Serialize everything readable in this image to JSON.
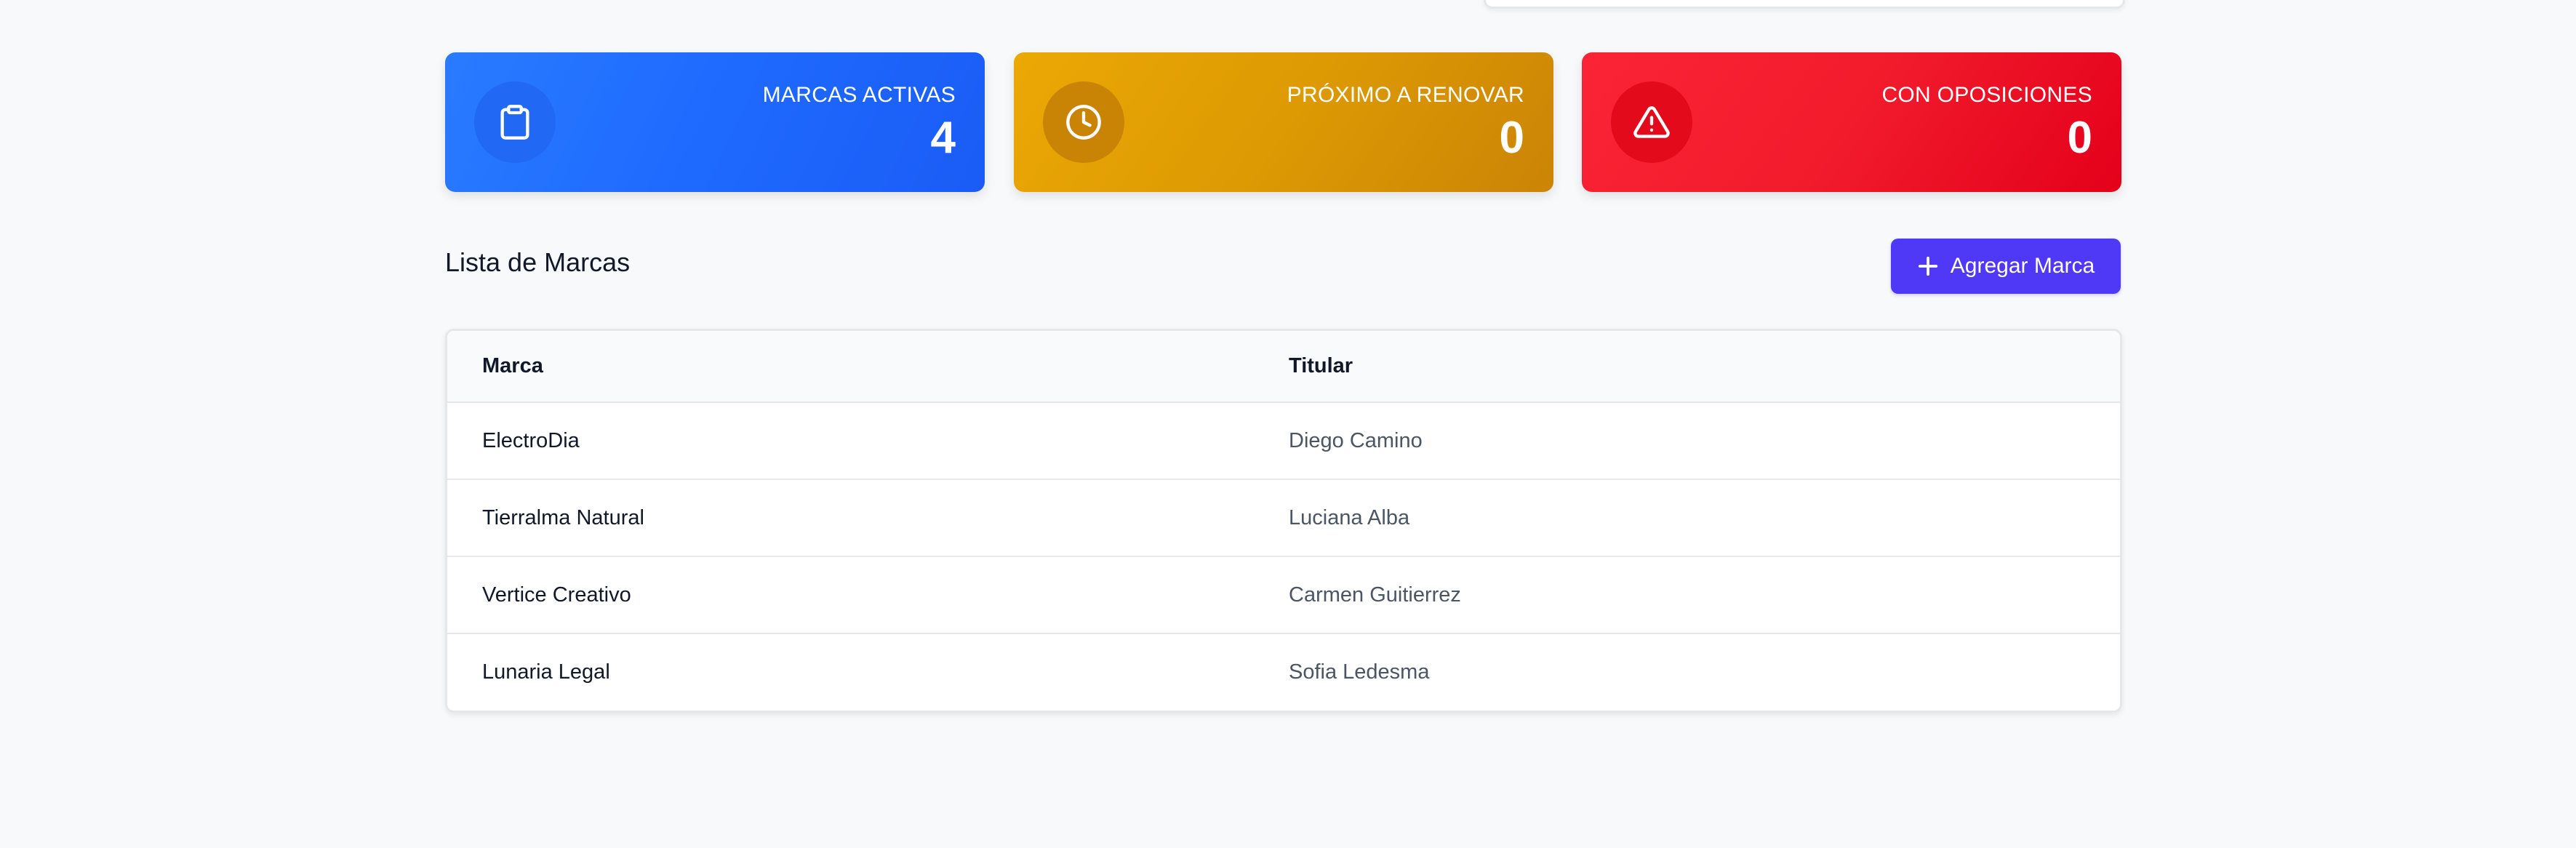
{
  "stats": [
    {
      "label": "MARCAS ACTIVAS",
      "value": "4",
      "icon": "clipboard-icon",
      "color": "#1f6bff"
    },
    {
      "label": "PRÓXIMO A RENOVAR",
      "value": "0",
      "icon": "clock-icon",
      "color": "#e09a04"
    },
    {
      "label": "CON OPOSICIONES",
      "value": "0",
      "icon": "warning-icon",
      "color": "#f11b2c"
    }
  ],
  "list": {
    "title": "Lista de Marcas",
    "add_button_label": "Agregar Marca",
    "add_button_icon": "plus-icon",
    "accent_color": "#4f39f6"
  },
  "table": {
    "columns": [
      "Marca",
      "Titular"
    ],
    "rows": [
      [
        "ElectroDia",
        "Diego Camino"
      ],
      [
        "Tierralma Natural",
        "Luciana Alba"
      ],
      [
        "Vertice Creativo",
        "Carmen Guitierrez"
      ],
      [
        "Lunaria Legal",
        "Sofia Ledesma"
      ]
    ]
  }
}
